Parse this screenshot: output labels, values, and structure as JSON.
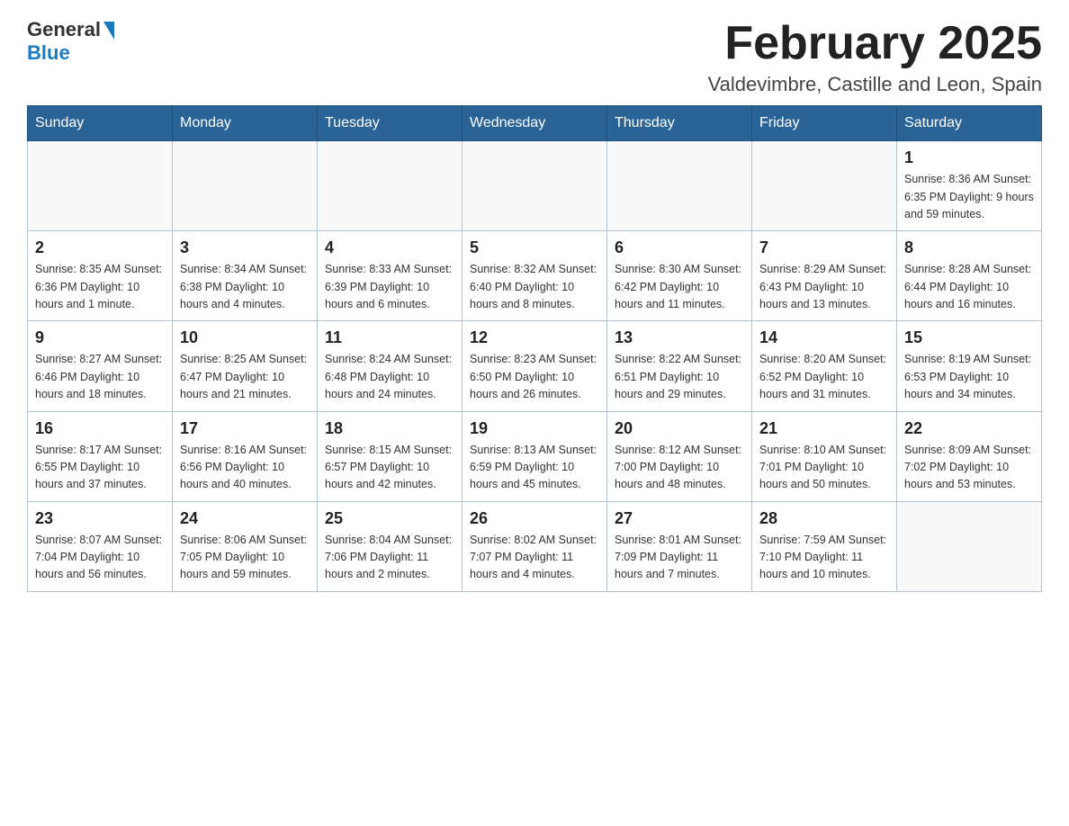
{
  "header": {
    "logo_general": "General",
    "logo_blue": "Blue",
    "main_title": "February 2025",
    "subtitle": "Valdevimbre, Castille and Leon, Spain"
  },
  "weekdays": [
    "Sunday",
    "Monday",
    "Tuesday",
    "Wednesday",
    "Thursday",
    "Friday",
    "Saturday"
  ],
  "weeks": [
    [
      {
        "day": "",
        "info": ""
      },
      {
        "day": "",
        "info": ""
      },
      {
        "day": "",
        "info": ""
      },
      {
        "day": "",
        "info": ""
      },
      {
        "day": "",
        "info": ""
      },
      {
        "day": "",
        "info": ""
      },
      {
        "day": "1",
        "info": "Sunrise: 8:36 AM\nSunset: 6:35 PM\nDaylight: 9 hours and 59 minutes."
      }
    ],
    [
      {
        "day": "2",
        "info": "Sunrise: 8:35 AM\nSunset: 6:36 PM\nDaylight: 10 hours and 1 minute."
      },
      {
        "day": "3",
        "info": "Sunrise: 8:34 AM\nSunset: 6:38 PM\nDaylight: 10 hours and 4 minutes."
      },
      {
        "day": "4",
        "info": "Sunrise: 8:33 AM\nSunset: 6:39 PM\nDaylight: 10 hours and 6 minutes."
      },
      {
        "day": "5",
        "info": "Sunrise: 8:32 AM\nSunset: 6:40 PM\nDaylight: 10 hours and 8 minutes."
      },
      {
        "day": "6",
        "info": "Sunrise: 8:30 AM\nSunset: 6:42 PM\nDaylight: 10 hours and 11 minutes."
      },
      {
        "day": "7",
        "info": "Sunrise: 8:29 AM\nSunset: 6:43 PM\nDaylight: 10 hours and 13 minutes."
      },
      {
        "day": "8",
        "info": "Sunrise: 8:28 AM\nSunset: 6:44 PM\nDaylight: 10 hours and 16 minutes."
      }
    ],
    [
      {
        "day": "9",
        "info": "Sunrise: 8:27 AM\nSunset: 6:46 PM\nDaylight: 10 hours and 18 minutes."
      },
      {
        "day": "10",
        "info": "Sunrise: 8:25 AM\nSunset: 6:47 PM\nDaylight: 10 hours and 21 minutes."
      },
      {
        "day": "11",
        "info": "Sunrise: 8:24 AM\nSunset: 6:48 PM\nDaylight: 10 hours and 24 minutes."
      },
      {
        "day": "12",
        "info": "Sunrise: 8:23 AM\nSunset: 6:50 PM\nDaylight: 10 hours and 26 minutes."
      },
      {
        "day": "13",
        "info": "Sunrise: 8:22 AM\nSunset: 6:51 PM\nDaylight: 10 hours and 29 minutes."
      },
      {
        "day": "14",
        "info": "Sunrise: 8:20 AM\nSunset: 6:52 PM\nDaylight: 10 hours and 31 minutes."
      },
      {
        "day": "15",
        "info": "Sunrise: 8:19 AM\nSunset: 6:53 PM\nDaylight: 10 hours and 34 minutes."
      }
    ],
    [
      {
        "day": "16",
        "info": "Sunrise: 8:17 AM\nSunset: 6:55 PM\nDaylight: 10 hours and 37 minutes."
      },
      {
        "day": "17",
        "info": "Sunrise: 8:16 AM\nSunset: 6:56 PM\nDaylight: 10 hours and 40 minutes."
      },
      {
        "day": "18",
        "info": "Sunrise: 8:15 AM\nSunset: 6:57 PM\nDaylight: 10 hours and 42 minutes."
      },
      {
        "day": "19",
        "info": "Sunrise: 8:13 AM\nSunset: 6:59 PM\nDaylight: 10 hours and 45 minutes."
      },
      {
        "day": "20",
        "info": "Sunrise: 8:12 AM\nSunset: 7:00 PM\nDaylight: 10 hours and 48 minutes."
      },
      {
        "day": "21",
        "info": "Sunrise: 8:10 AM\nSunset: 7:01 PM\nDaylight: 10 hours and 50 minutes."
      },
      {
        "day": "22",
        "info": "Sunrise: 8:09 AM\nSunset: 7:02 PM\nDaylight: 10 hours and 53 minutes."
      }
    ],
    [
      {
        "day": "23",
        "info": "Sunrise: 8:07 AM\nSunset: 7:04 PM\nDaylight: 10 hours and 56 minutes."
      },
      {
        "day": "24",
        "info": "Sunrise: 8:06 AM\nSunset: 7:05 PM\nDaylight: 10 hours and 59 minutes."
      },
      {
        "day": "25",
        "info": "Sunrise: 8:04 AM\nSunset: 7:06 PM\nDaylight: 11 hours and 2 minutes."
      },
      {
        "day": "26",
        "info": "Sunrise: 8:02 AM\nSunset: 7:07 PM\nDaylight: 11 hours and 4 minutes."
      },
      {
        "day": "27",
        "info": "Sunrise: 8:01 AM\nSunset: 7:09 PM\nDaylight: 11 hours and 7 minutes."
      },
      {
        "day": "28",
        "info": "Sunrise: 7:59 AM\nSunset: 7:10 PM\nDaylight: 11 hours and 10 minutes."
      },
      {
        "day": "",
        "info": ""
      }
    ]
  ]
}
